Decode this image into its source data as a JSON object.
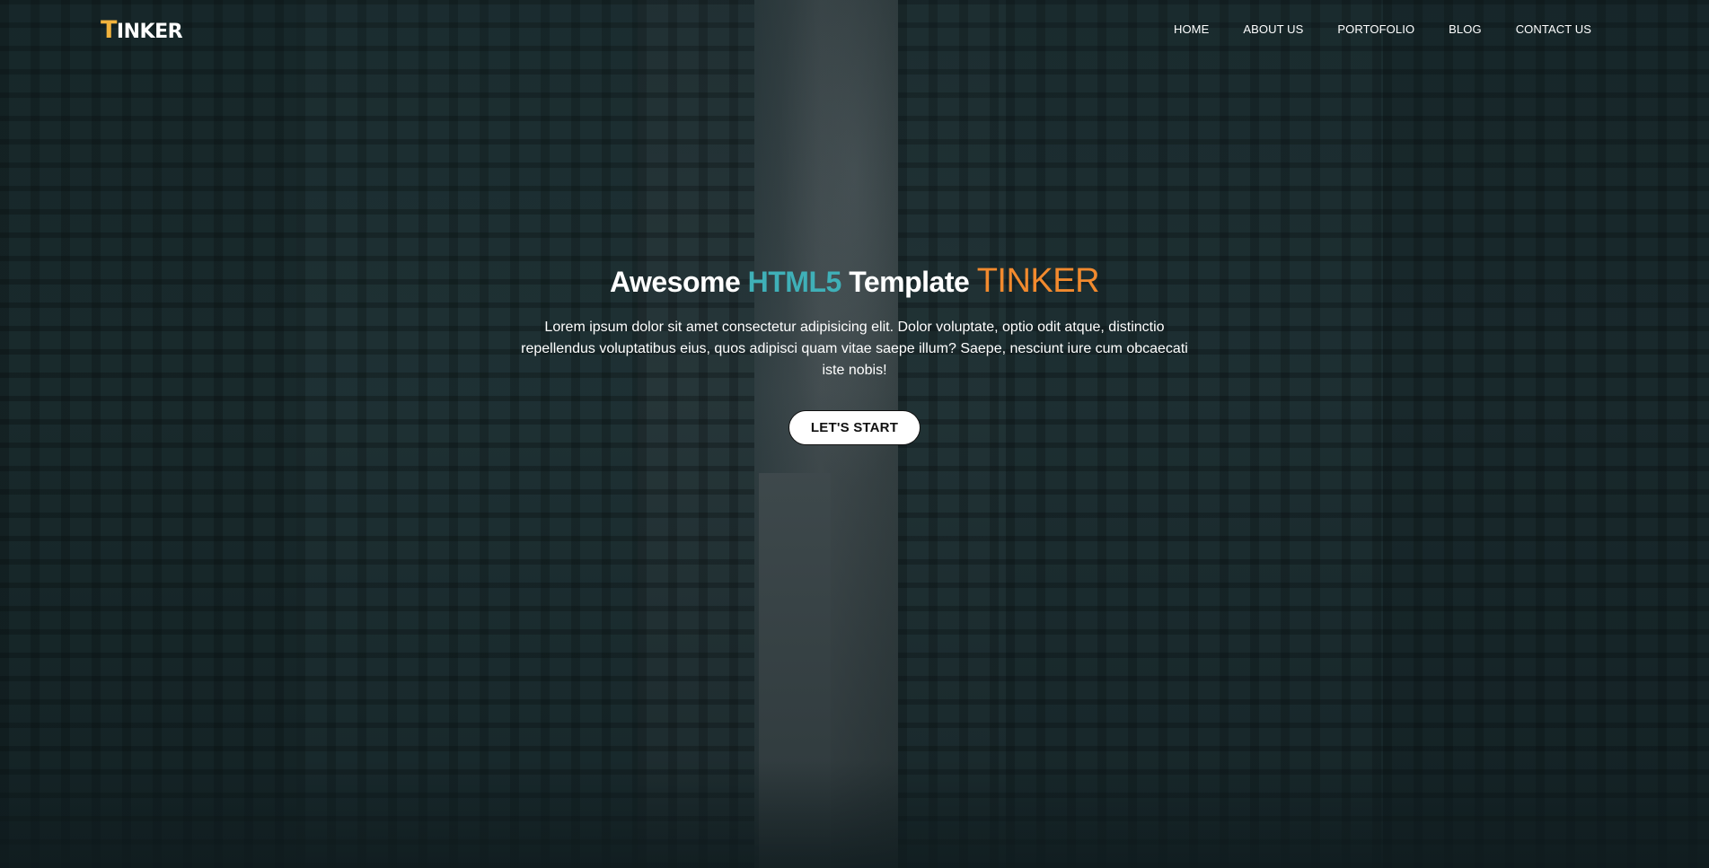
{
  "header": {
    "logo_first_letter": "T",
    "logo_rest": "INKER"
  },
  "nav": {
    "items": [
      {
        "label": "HOME"
      },
      {
        "label": "ABOUT US"
      },
      {
        "label": "PORTOFOLIO"
      },
      {
        "label": "BLOG"
      },
      {
        "label": "CONTACT US"
      }
    ]
  },
  "hero": {
    "headline_part1": "Awesome",
    "headline_part2": "HTML5",
    "headline_part3": "Template",
    "headline_part4": "TINKER",
    "paragraph": "Lorem ipsum dolor sit amet consectetur adipisicing elit. Dolor voluptate, optio odit atque, distinctio repellendus voluptatibus eius, quos adipisci quam vitae saepe illum? Saepe, nesciunt iure cum obcaecati iste nobis!",
    "cta_label": "LET'S START"
  },
  "colors": {
    "logo_accent": "#f2b33d",
    "headline_teal": "#3fb0b8",
    "headline_orange": "#f28a2e"
  }
}
